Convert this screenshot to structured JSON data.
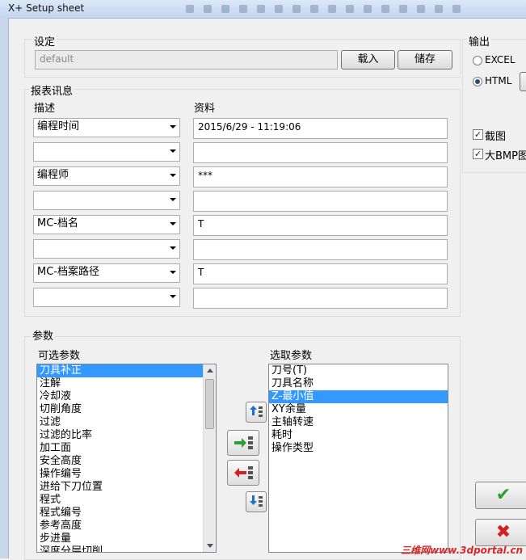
{
  "window": {
    "title": "X+ Setup sheet"
  },
  "settings": {
    "section_label": "设定",
    "name_value": "default",
    "load_label": "载入",
    "save_label": "储存"
  },
  "output": {
    "section_label": "输出",
    "options": [
      "EXCEL",
      "HTML"
    ],
    "selected": "HTML",
    "screenshot_label": "截图",
    "large_bmp_label": "大BMP图"
  },
  "report_info": {
    "section_label": "报表讯息",
    "desc_header": "描述",
    "data_header": "资料",
    "rows": [
      {
        "desc": "编程时间",
        "value": "2015/6/29 - 11:19:06"
      },
      {
        "desc": "",
        "value": ""
      },
      {
        "desc": "编程师",
        "value": "***"
      },
      {
        "desc": "",
        "value": ""
      },
      {
        "desc": "MC-档名",
        "value": "T"
      },
      {
        "desc": "",
        "value": ""
      },
      {
        "desc": "MC-档案路径",
        "value": "T"
      },
      {
        "desc": "",
        "value": ""
      }
    ]
  },
  "parameters": {
    "section_label": "参数",
    "available_label": "可选参数",
    "selected_label": "选取参数",
    "available": [
      "刀具补正",
      "注解",
      "冷却液",
      "切削角度",
      "过滤",
      "过滤的比率",
      "加工面",
      "安全高度",
      "操作编号",
      "进给下刀位置",
      "程式",
      "程式编号",
      "参考高度",
      "步进量",
      "深度分层切削"
    ],
    "available_selected": "刀具补正",
    "chosen": [
      "刀号(T)",
      "刀具名称",
      "Z-最小值",
      "XY余量",
      "主轴转速",
      "耗时",
      "操作类型"
    ],
    "chosen_selected": "Z-最小值"
  },
  "watermark": "三维网www.3dportal.cn",
  "colors": {
    "selection": "#3399ff",
    "ok_check": "#2e9e2e",
    "cancel_x": "#d42020"
  }
}
